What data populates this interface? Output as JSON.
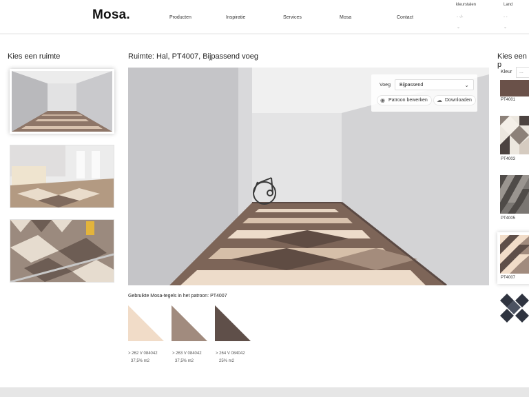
{
  "header": {
    "logo": "Mosa.",
    "nav": [
      "Producten",
      "Inspiratie",
      "Services",
      "Mosa",
      "Contact"
    ],
    "util": {
      "kleurstalen_label": "kleurstalen",
      "kleurstalen_value": "- -/-",
      "land_label": "Land",
      "land_value": "- -"
    }
  },
  "left": {
    "title": "Kies een ruimte"
  },
  "main": {
    "title": "Ruimte: Hal, PT4007, Bijpassend voeg",
    "controls": {
      "voeg_label": "Voeg",
      "voeg_value": "Bijpassend",
      "edit_button": "Patroon bewerken",
      "download_button": "Downloaden"
    },
    "tiles_title": "Gebruikte Mosa-tegels in het patroon: PT4007",
    "tiles": [
      {
        "code": "> 262    V    084042",
        "pct": "37,5% m2",
        "color": "#f1dcc8"
      },
      {
        "code": "> 263    V    084042",
        "pct": "37,5% m2",
        "color": "#a18b7e"
      },
      {
        "code": "> 264    V    084042",
        "pct": "25% m2",
        "color": "#5f4f49"
      }
    ]
  },
  "right": {
    "title": "Kies een p",
    "kleur_label": "Kleur",
    "kleur_value": "...",
    "patterns": [
      "PT4001",
      "PT4003",
      "PT4005",
      "PT4007"
    ]
  },
  "colors": {
    "accent": "#111111",
    "tile_light": "#f1dcc8",
    "tile_mid": "#a18b7e",
    "tile_dark": "#5f4f49"
  }
}
